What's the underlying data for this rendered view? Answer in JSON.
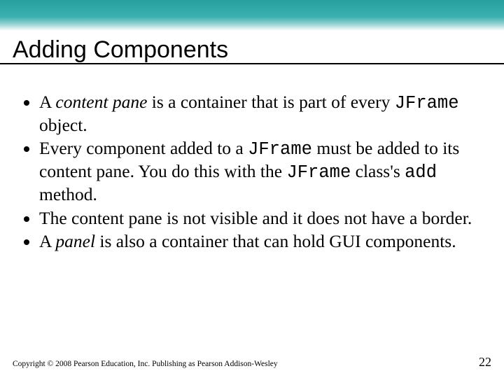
{
  "title": "Adding Components",
  "bullets": [
    {
      "pre": "A ",
      "em": "content pane",
      "mid": " is a container that is part of every ",
      "code": "JFrame",
      "post": " object."
    },
    {
      "pre": "Every component added to a ",
      "code1": "JFrame",
      "mid1": " must be added to its content pane. You do this with the ",
      "code2": "JFrame",
      "mid2": " class's ",
      "code3": "add",
      "post": " method."
    },
    {
      "text": "The content pane is not visible and it does not have a border."
    },
    {
      "pre": "A ",
      "em": "panel",
      "post": " is also a container that can hold GUI components."
    }
  ],
  "footer": {
    "copyright": "Copyright © 2008 Pearson Education, Inc. Publishing as Pearson Addison-Wesley",
    "page": "22"
  }
}
